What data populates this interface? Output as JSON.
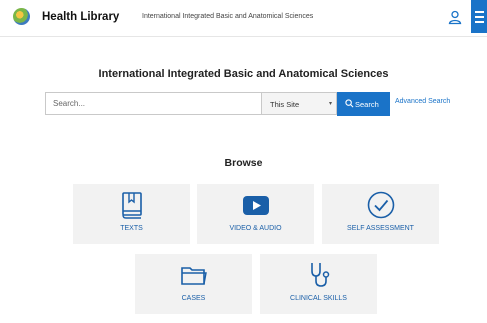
{
  "header": {
    "brand": "Health Library",
    "subtitle": "International Integrated Basic and Anatomical Sciences"
  },
  "main": {
    "title": "International Integrated Basic and Anatomical Sciences"
  },
  "search": {
    "placeholder": "Search...",
    "value": "",
    "scope": "This Site",
    "button_label": "Search",
    "advanced_label": "Advanced Search"
  },
  "browse": {
    "title": "Browse",
    "tiles": [
      {
        "label": "TEXTS",
        "icon": "book-icon"
      },
      {
        "label": "VIDEO & AUDIO",
        "icon": "play-icon"
      },
      {
        "label": "SELF ASSESSMENT",
        "icon": "check-circle-icon"
      },
      {
        "label": "CASES",
        "icon": "folder-icon"
      },
      {
        "label": "CLINICAL SKILLS",
        "icon": "stethoscope-icon"
      }
    ]
  },
  "colors": {
    "accent": "#1a73c8",
    "tile_bg": "#f2f2f2",
    "tile_label": "#1a5fa8"
  }
}
